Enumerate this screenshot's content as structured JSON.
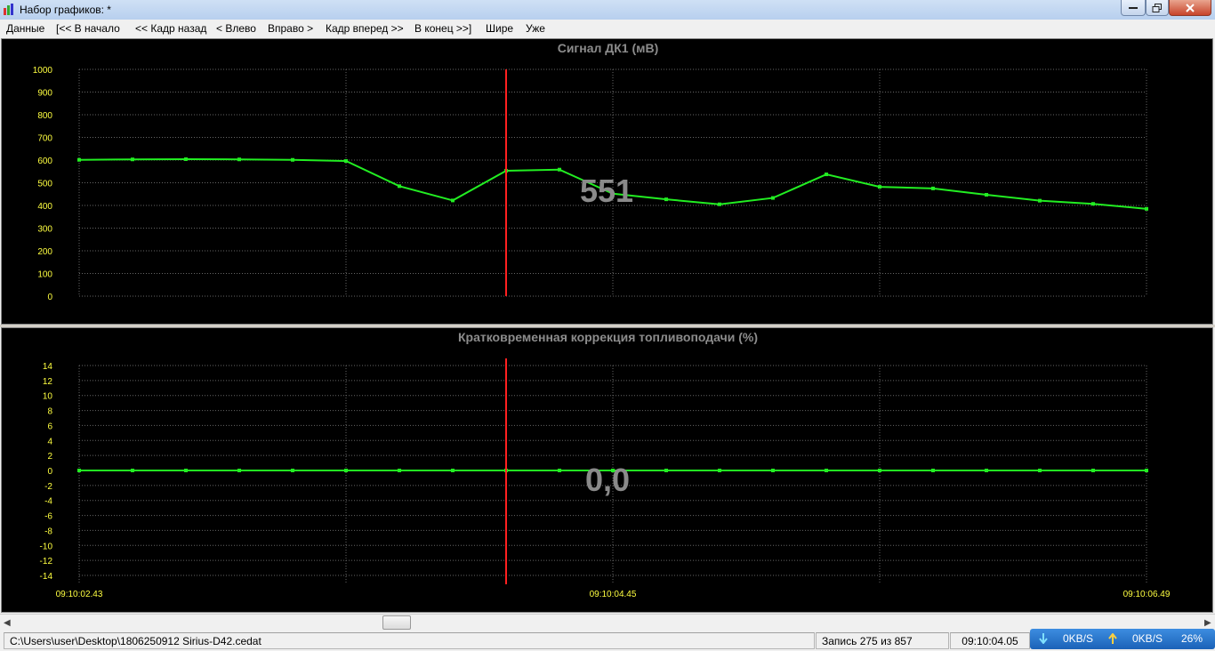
{
  "window": {
    "title": "Набор графиков: *"
  },
  "menu": {
    "data": "Данные",
    "to_start": "[<< В начало",
    "frame_back": "<< Кадр назад",
    "left": "< Влево",
    "right": "Вправо >",
    "frame_forward": "Кадр вперед >>",
    "to_end": "В конец >>]",
    "wider": "Шире",
    "narrower": "Уже"
  },
  "chart_data": [
    {
      "type": "line",
      "title": "Сигнал ДК1  (мВ)",
      "ylim": [
        0,
        1000
      ],
      "y_ticks": [
        "1000",
        "900",
        "800",
        "700",
        "600",
        "500",
        "400",
        "300",
        "200",
        "100",
        "0"
      ],
      "x": [
        0,
        1,
        2,
        3,
        4,
        5,
        6,
        7,
        8,
        9,
        10,
        11,
        12,
        13,
        14,
        15,
        16,
        17,
        18,
        19,
        20
      ],
      "series": [
        {
          "values": [
            601,
            603,
            604,
            603,
            601,
            596,
            485,
            422,
            553,
            558,
            452,
            427,
            405,
            433,
            537,
            482,
            475,
            447,
            421,
            407,
            385
          ]
        }
      ],
      "cursor_index": 8,
      "cursor_value": "551",
      "grid": true,
      "colors": {
        "line": "#22ee22",
        "cursor": "#ff2020",
        "tick": "#ffff40",
        "grid": "#666666"
      }
    },
    {
      "type": "line",
      "title": "Кратковременная коррекция топливоподачи  (%)",
      "ylim": [
        -14,
        14
      ],
      "y_ticks": [
        "14",
        "12",
        "10",
        "8",
        "6",
        "4",
        "2",
        "0",
        "-2",
        "-4",
        "-6",
        "-8",
        "-10",
        "-12",
        "-14"
      ],
      "x": [
        0,
        1,
        2,
        3,
        4,
        5,
        6,
        7,
        8,
        9,
        10,
        11,
        12,
        13,
        14,
        15,
        16,
        17,
        18,
        19,
        20
      ],
      "series": [
        {
          "values": [
            0,
            0,
            0,
            0,
            0,
            0,
            0,
            0,
            0,
            0,
            0,
            0,
            0,
            0,
            0,
            0,
            0,
            0,
            0,
            0,
            0
          ]
        }
      ],
      "cursor_index": 8,
      "cursor_value": "0,0",
      "x_time_labels": [
        "09:10:02.43",
        "09:10:04.45",
        "09:10:06.49"
      ],
      "grid": true,
      "colors": {
        "line": "#22ee22",
        "cursor": "#ff2020",
        "tick": "#ffff40",
        "grid": "#666666"
      }
    }
  ],
  "status": {
    "file_path": "C:\\Users\\user\\Desktop\\1806250912 Sirius-D42.cedat",
    "record": "Запись 275 из 857",
    "time": "09:10:04.05"
  },
  "network": {
    "download": "0KB/S",
    "upload": "0KB/S",
    "cpu": "26%"
  }
}
